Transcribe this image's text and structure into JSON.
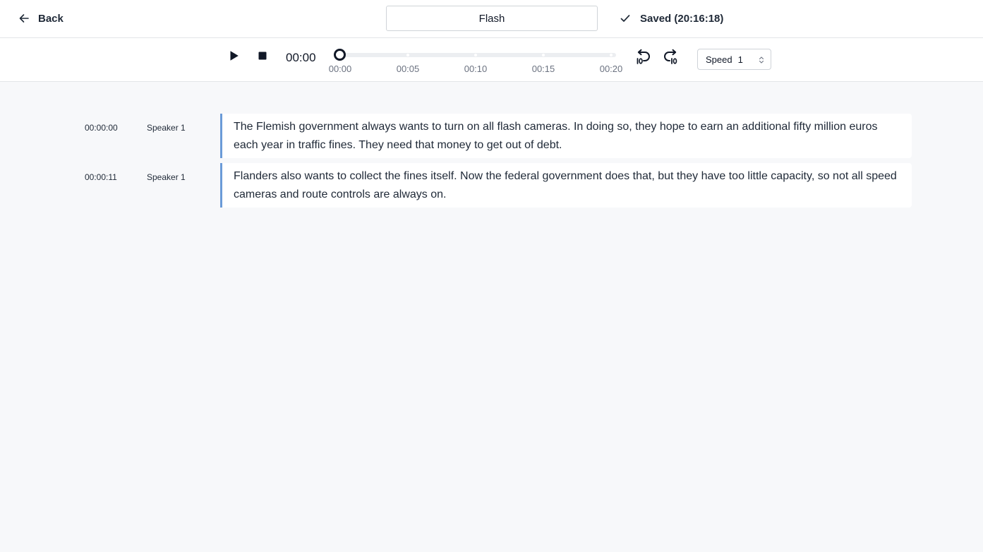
{
  "header": {
    "back_label": "Back",
    "title_value": "Flash",
    "saved_status": "Saved (20:16:18)"
  },
  "player": {
    "current_time": "00:00",
    "progress": 0,
    "ticks": [
      "00:00",
      "00:05",
      "00:10",
      "00:15",
      "00:20"
    ],
    "speed_label": "Speed",
    "speed_value": "1",
    "icons": [
      "play-icon",
      "stop-icon",
      "rewind-10-icon",
      "forward-10-icon"
    ]
  },
  "segments": [
    {
      "timestamp": "00:00:00",
      "speaker": "Speaker 1",
      "text": "The Flemish government always wants to turn on all flash cameras. In doing so, they hope to earn an additional fifty million euros each year in traffic fines. They need that money to get out of debt."
    },
    {
      "timestamp": "00:00:11",
      "speaker": "Speaker 1",
      "text": "Flanders also wants to collect the fines itself. Now the federal government does that, but they have too little capacity, so not all speed cameras and route controls are always on."
    }
  ],
  "colors": {
    "accent_border": "#6b9bd8",
    "page_background": "#f7f8fa"
  }
}
